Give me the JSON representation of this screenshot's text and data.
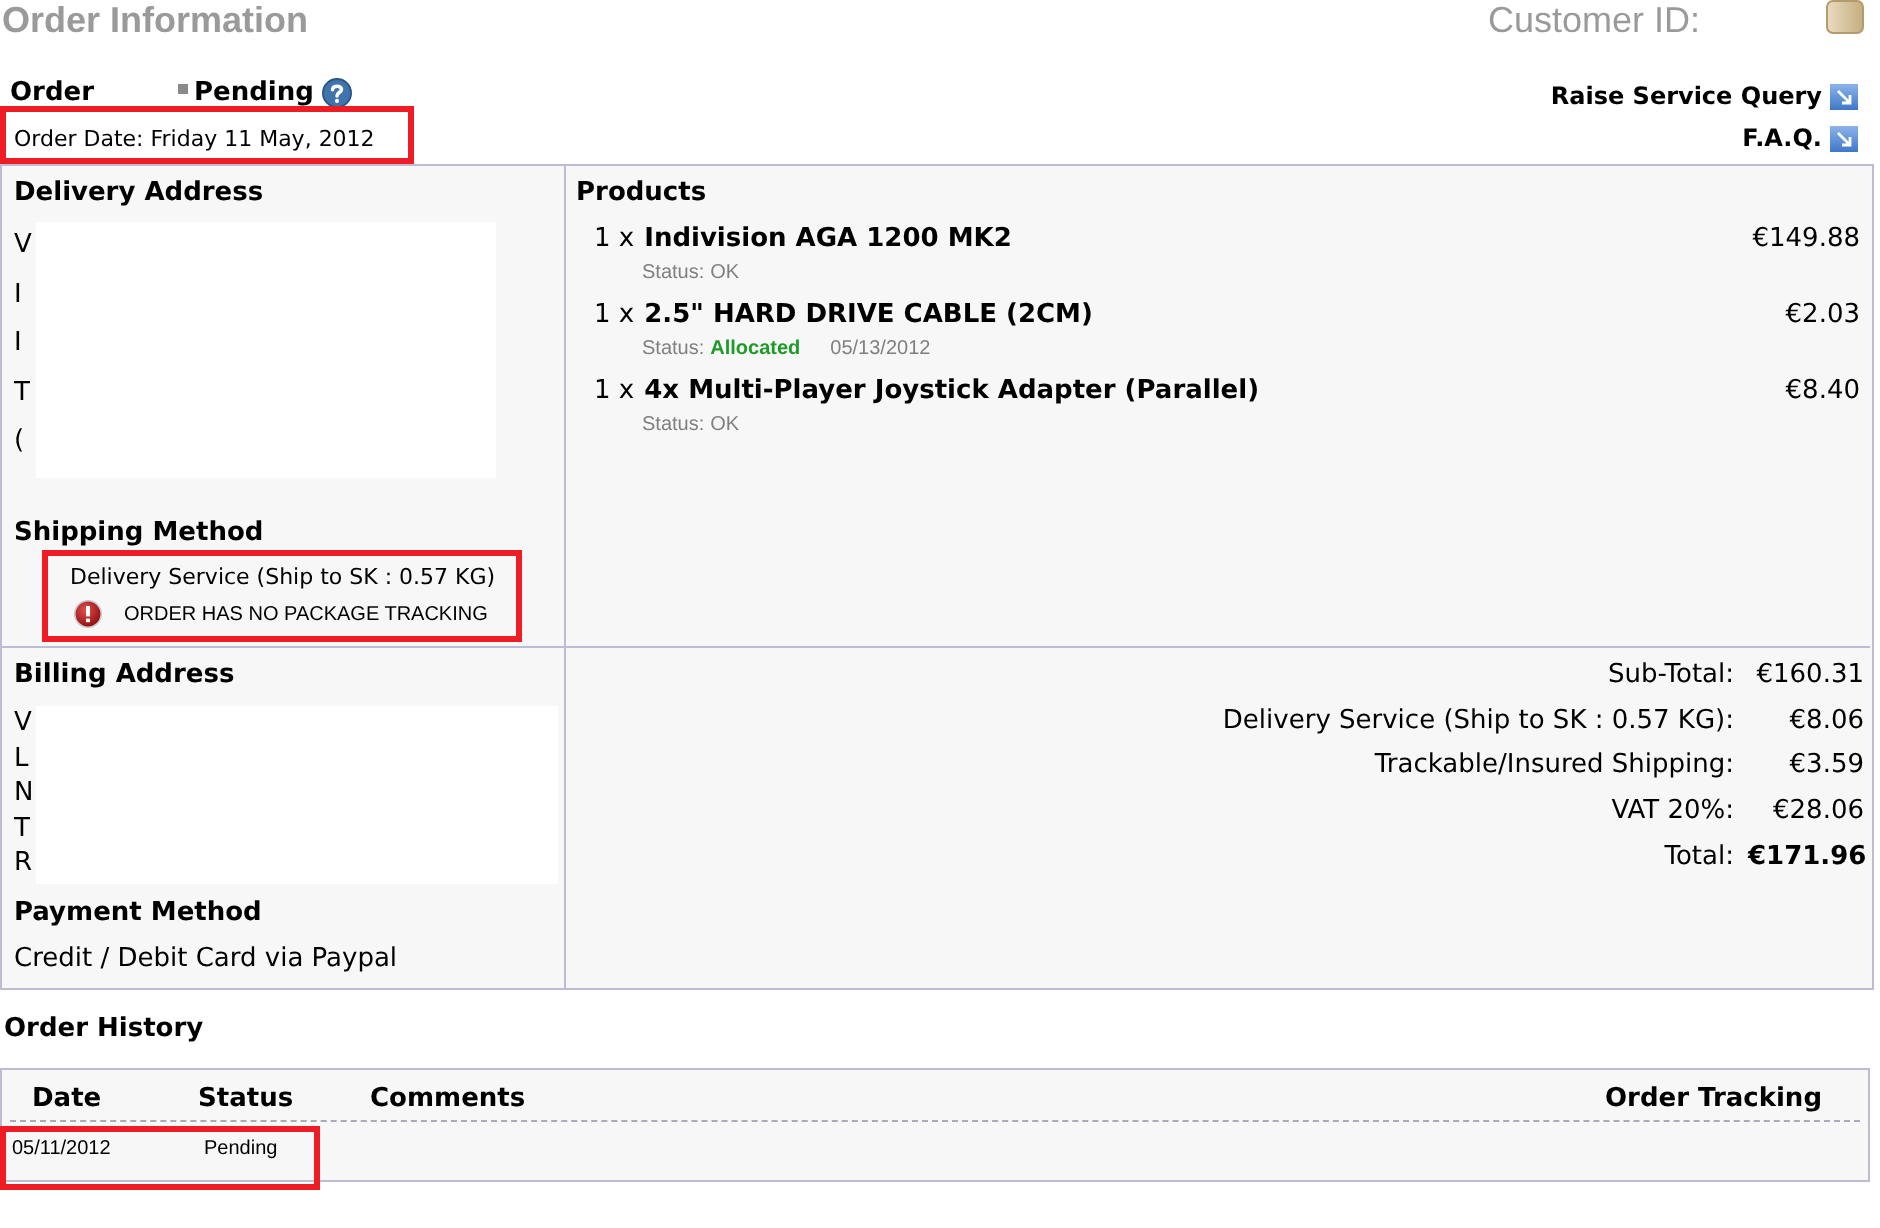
{
  "header": {
    "title": "Order Information",
    "customer_id_label": "Customer ID:"
  },
  "order": {
    "label": "Order",
    "status": "Pending",
    "date": "Order Date: Friday 11 May, 2012",
    "date_highlighted": true
  },
  "links": [
    {
      "label": "Raise Service Query"
    },
    {
      "label": "F.A.Q."
    }
  ],
  "delivery_address": {
    "heading": "Delivery Address",
    "line_fragments": [
      "V",
      "I",
      "I",
      "T",
      "("
    ]
  },
  "shipping": {
    "heading": "Shipping Method",
    "service": "Delivery Service (Ship to SK : 0.57 KG)",
    "tracking_notice": "ORDER HAS NO PACKAGE TRACKING",
    "highlighted": true
  },
  "products": {
    "heading": "Products",
    "items": [
      {
        "quantity": "1 x",
        "name": "Indivision AGA 1200 MK2",
        "price": "€149.88",
        "status": {
          "label": "Status:",
          "text": "OK",
          "kind": "ok"
        }
      },
      {
        "quantity": "1 x",
        "name": "2.5\" HARD DRIVE CABLE (2CM)",
        "price": "€2.03",
        "status": {
          "label": "Status:",
          "text": "Allocated",
          "kind": "allocated",
          "date": "05/13/2012"
        }
      },
      {
        "quantity": "1 x",
        "name": "4x Multi-Player Joystick Adapter (Parallel)",
        "price": "€8.40",
        "status": {
          "label": "Status:",
          "text": "OK",
          "kind": "ok"
        }
      }
    ]
  },
  "billing_address": {
    "heading": "Billing Address",
    "line_fragments": [
      "V",
      "L",
      "N",
      "T",
      "R"
    ]
  },
  "payment": {
    "heading": "Payment Method",
    "method": "Credit / Debit Card via Paypal"
  },
  "totals": [
    {
      "label": "Sub-Total:",
      "value": "€160.31",
      "emphasis": false
    },
    {
      "label": "Delivery Service (Ship to SK : 0.57 KG):",
      "value": "€8.06",
      "emphasis": false
    },
    {
      "label": "Trackable/Insured Shipping:",
      "value": "€3.59",
      "emphasis": false
    },
    {
      "label": "VAT 20%:",
      "value": "€28.06",
      "emphasis": false
    },
    {
      "label": "Total:",
      "value": "€171.96",
      "emphasis": true
    }
  ],
  "order_history": {
    "heading": "Order History",
    "columns": [
      "Date",
      "Status",
      "Comments",
      "Order Tracking"
    ],
    "rows": [
      {
        "date": "05/11/2012",
        "status": "Pending",
        "highlighted": true
      }
    ]
  }
}
